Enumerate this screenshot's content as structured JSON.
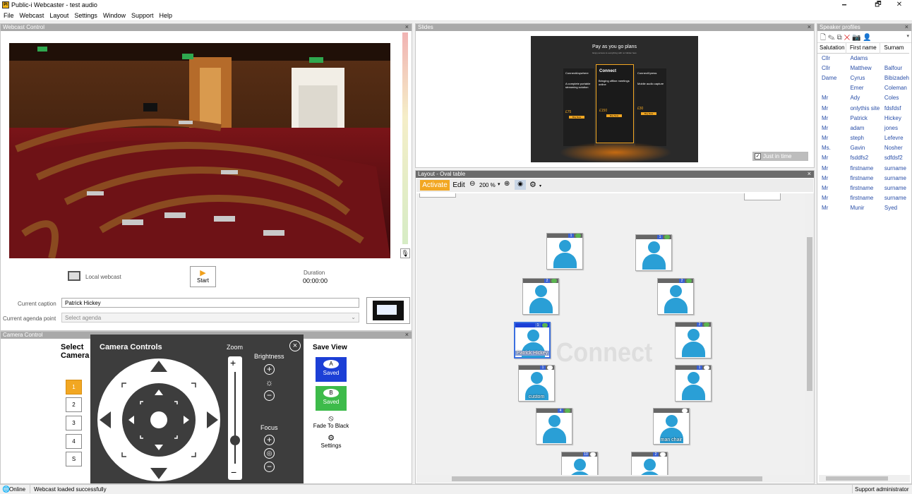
{
  "window": {
    "title": "Public-i Webcaster - test audio",
    "controls": [
      "🗕",
      "🗗",
      "✕"
    ]
  },
  "menu": [
    "File",
    "Webcast",
    "Layout",
    "Settings",
    "Window",
    "Support",
    "Help"
  ],
  "webcast": {
    "header": "Webcast Control",
    "close": "×",
    "local_label": "Local webcast",
    "start_label": "Start",
    "duration_label": "Duration",
    "duration_value": "00:00:00",
    "caption_label": "Current caption",
    "caption_value": "Patrick Hickey",
    "agenda_label": "Current agenda point",
    "agenda_placeholder": "Select agenda"
  },
  "camera": {
    "header": "Camera Control",
    "select_label": "Select",
    "select_label2": "Camera",
    "controls_title": "Camera Controls",
    "zoom_label": "Zoom",
    "brightness_label": "Brightness",
    "focus_label": "Focus",
    "save_view_label": "Save View",
    "cameras": [
      "1",
      "2",
      "3",
      "4",
      "S"
    ],
    "preset_a": "A",
    "preset_b": "B",
    "saved_label": "Saved",
    "fade_label": "Fade To Black",
    "settings_label": "Settings",
    "zoom_level": 0.25,
    "colors": {
      "preset_a": "#1c3fd6",
      "preset_b": "#3dbb4a",
      "selected_cam": "#f2a722"
    }
  },
  "slides": {
    "header": "Slides",
    "close": "×",
    "jit_label": "Just in time slides",
    "slide": {
      "title": "Pay as you go plans",
      "subtitle": "Enjoy access to everything with no hidden fees",
      "plan_left": "ConnectAnywhere",
      "plan_mid": "Connect",
      "plan_right": "ConnectXpress",
      "tag_left": "A complete portable streaming solution",
      "tag_mid": "Bringing offline meetings online",
      "tag_right": "Mobile audio capture",
      "price_left": "£75",
      "price_mid": "£150",
      "price_right": "£30",
      "buy": "Buy Now"
    }
  },
  "layout": {
    "header": "Layout - Oval table",
    "close": "×",
    "activate": "Activate",
    "edit": "Edit",
    "zoom": "200 %",
    "watermark": "Connect",
    "seats": [
      {
        "name": "",
        "num": "1"
      },
      {
        "name": "",
        "num": "1"
      },
      {
        "name": "",
        "num": "2"
      },
      {
        "name": "",
        "num": "2"
      },
      {
        "name": "Patrick Hickey",
        "num": "1"
      },
      {
        "name": "",
        "num": "2"
      },
      {
        "name": "custom",
        "num": "1"
      },
      {
        "name": "",
        "num": "1"
      },
      {
        "name": "",
        "num": "4"
      },
      {
        "name": "man chair",
        "num": ""
      },
      {
        "name": "",
        "num": "10"
      },
      {
        "name": "",
        "num": "2"
      }
    ]
  },
  "speakers": {
    "header": "Speaker profiles",
    "columns": [
      "Salutation",
      "First name",
      "Surnam"
    ],
    "rows": [
      [
        "Cllr",
        "Adams",
        ""
      ],
      [
        "Cllr",
        "Matthew",
        "Balfour"
      ],
      [
        "Dame",
        "Cyrus",
        "Bibizadeh"
      ],
      [
        "",
        "Emer",
        "Coleman"
      ],
      [
        "Mr",
        "Ady",
        "Coles"
      ],
      [
        "Mr",
        "onlythis site",
        "fdsfdsf"
      ],
      [
        "Mr",
        "Patrick",
        "Hickey"
      ],
      [
        "Mr",
        "adam",
        "jones"
      ],
      [
        "Mr",
        "steph",
        "Lefevre"
      ],
      [
        "Ms.",
        "Gavin",
        "Nosher"
      ],
      [
        "Mr",
        "fsddfs2",
        "sdfdsf2"
      ],
      [
        "Mr",
        "firstname",
        "surname"
      ],
      [
        "Mr",
        "firstname",
        "surname"
      ],
      [
        "Mr",
        "firstname",
        "surname"
      ],
      [
        "Mr",
        "firstname",
        "surname"
      ],
      [
        "Mr",
        "Munir",
        "Syed"
      ]
    ]
  },
  "status": {
    "online": "Online",
    "message": "Webcast loaded successfully",
    "user": "Support administrator"
  }
}
